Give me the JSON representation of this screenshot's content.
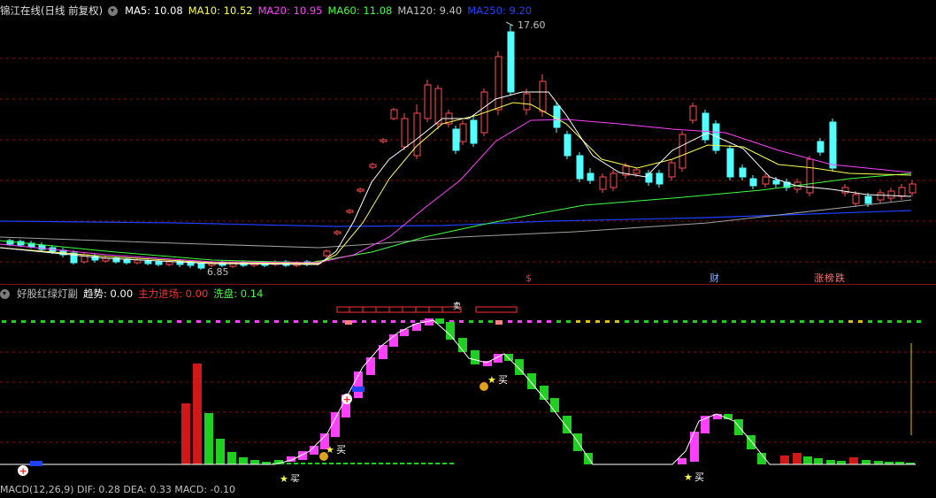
{
  "top_bar": {
    "title": "锦江在线(日线 前复权)",
    "ma5_label": "MA5: 10.08",
    "ma10_label": "MA10: 10.52",
    "ma20_label": "MA20: 10.95",
    "ma60_label": "MA60: 11.08",
    "ma120_label": "MA120: 9.40",
    "ma250_label": "MA250: 9.20"
  },
  "price_chart": {
    "high_label": "17.60",
    "low_label": "6.85",
    "markers": {
      "s": "$",
      "cai": "财",
      "zhang": "涨",
      "bang": "榜",
      "die": "跌"
    }
  },
  "indicator_bar": {
    "title": "好股红绿灯副",
    "trend": "趋势: 0.00",
    "main_force": "主力进场: 0.00",
    "wash": "洗盘: 0.14"
  },
  "indicator_chart": {
    "buy_label": "买",
    "sell_label": "卖"
  },
  "bottom_bar": {
    "text": "MACD(12,26,9)  DIF: 0.28  DEA: 0.33  MACD: -0.10"
  },
  "colors": {
    "up": "#ff5050",
    "down": "#54ffff",
    "ma5": "#ffffff",
    "ma10": "#ffff50",
    "ma20": "#ff40ff",
    "ma60": "#40ff40",
    "ma120": "#c0c0c0",
    "ma250": "#2040ff"
  }
}
